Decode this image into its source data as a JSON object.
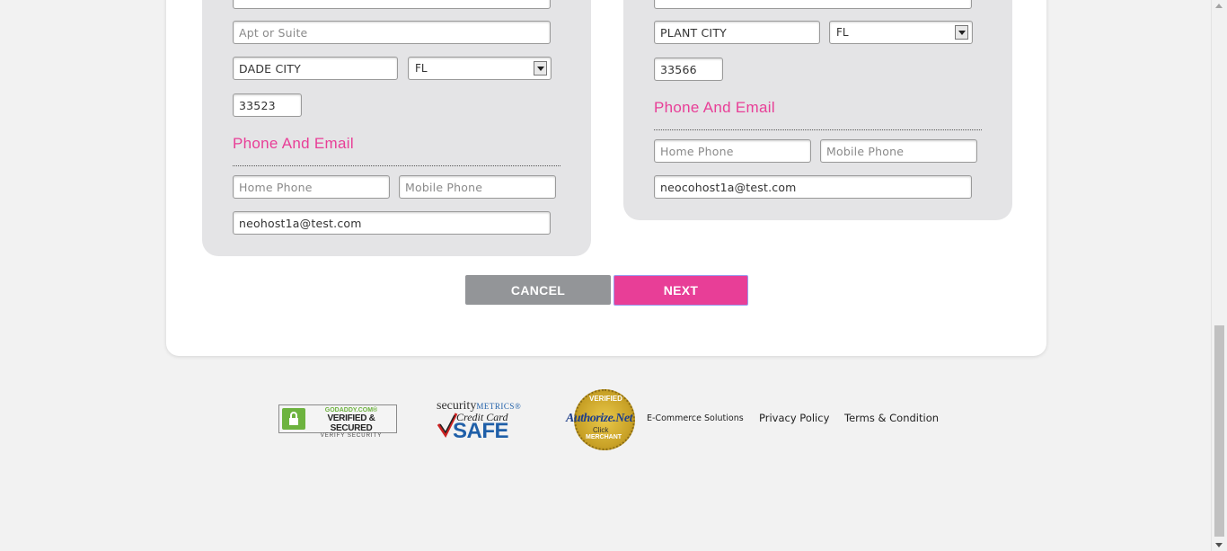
{
  "billing": {
    "street_value": "",
    "apt_placeholder": "Apt or Suite",
    "apt_value": "",
    "city_value": "DADE CITY",
    "state_value": "FL",
    "zip_value": "33523",
    "phone_section_title": "Phone And Email",
    "home_phone_placeholder": "Home Phone",
    "mobile_phone_placeholder": "Mobile Phone",
    "email_value": "neohost1a@test.com"
  },
  "shipping": {
    "street_value": "",
    "city_value": "PLANT CITY",
    "state_value": "FL",
    "zip_value": "33566",
    "phone_section_title": "Phone And Email",
    "home_phone_placeholder": "Home Phone",
    "mobile_phone_placeholder": "Mobile Phone",
    "email_value": "neocohost1a@test.com"
  },
  "actions": {
    "cancel_label": "CANCEL",
    "next_label": "NEXT"
  },
  "badges": {
    "godaddy": {
      "line1": "GODADDY.COM®",
      "line2": "VERIFIED & SECURED",
      "line3": "VERIFY SECURITY",
      "icon": "lock-icon"
    },
    "securitymetrics": {
      "brand_prefix": "security",
      "brand_suffix": "METRICS®",
      "line2": "Credit Card",
      "line3": "SAFE",
      "icon": "checkmark-icon"
    },
    "authorize": {
      "top": "VERIFIED",
      "name": "Authorize.Net",
      "click": "Click",
      "bottom": "MERCHANT"
    }
  },
  "footer": {
    "ecommerce_label": "E-Commerce Solutions",
    "privacy_label": "Privacy Policy",
    "terms_label": "Terms & Condition"
  },
  "colors": {
    "accent": "#e83e97",
    "cancel_gray": "#939598",
    "panel_gray": "#e4e4e6"
  }
}
